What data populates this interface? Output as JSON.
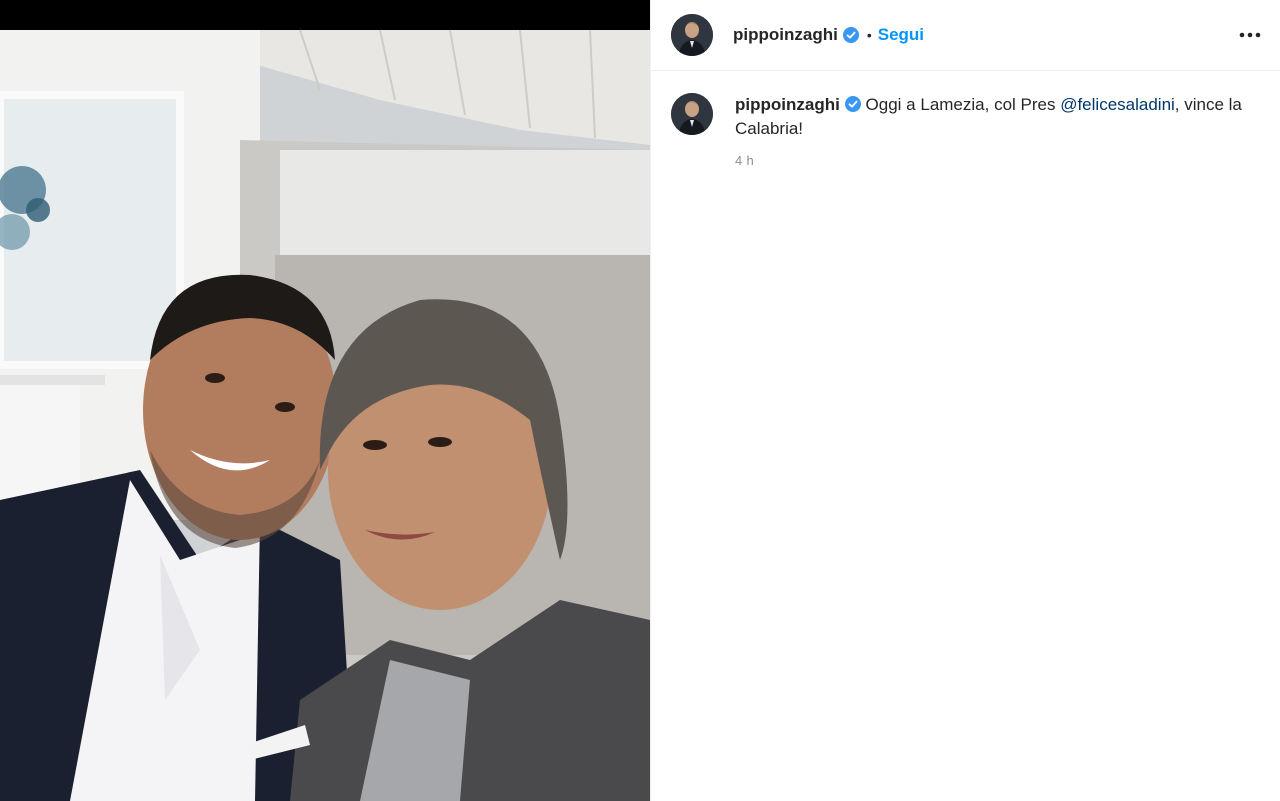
{
  "post": {
    "author": {
      "username": "pippoinzaghi",
      "verified": true,
      "avatar_icon": "profile-avatar"
    },
    "header": {
      "separator": "•",
      "follow_label": "Segui",
      "more_icon": "more-horizontal-icon"
    },
    "caption": {
      "username": "pippoinzaghi",
      "text_before": " Oggi a Lamezia, col Pres ",
      "mention": "@felicesaladini",
      "text_after": ", vince la Calabria!",
      "time": "4 h"
    },
    "colors": {
      "link_blue": "#0095f6",
      "mention_blue": "#00376b",
      "verified_blue": "#3897f0",
      "muted": "#8e8e8e"
    }
  }
}
